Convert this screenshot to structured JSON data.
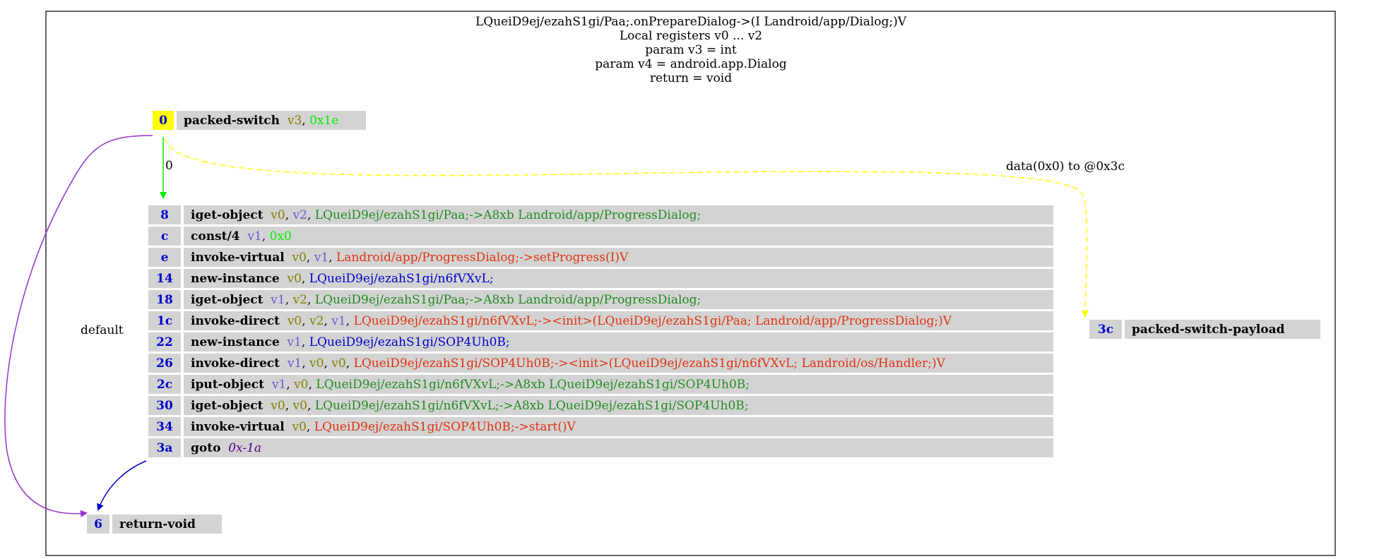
{
  "header": {
    "lines": [
      "LQueiD9ej/ezahS1gi/Paa;.onPrepareDialog->(I Landroid/app/Dialog;)V",
      "Local registers v0 ... v2",
      "param v3 = int",
      "param v4 = android.app.Dialog",
      "return = void"
    ]
  },
  "colors": {
    "frame": "#333333",
    "cell_bg": "#d3d3d3",
    "entry_addr_bg": "#ffff00",
    "addr": "#0000cd",
    "opcode": "#000000",
    "register": "#808000",
    "register_alt": "#6a5acd",
    "literal": "#00ee00",
    "field_ref": "#228b22",
    "method_ref": "#dd3311",
    "type_ref": "#0000cd",
    "offset": "#4b0082",
    "edge_default": "#9932cc",
    "edge_case": "#00ee00",
    "edge_data": "#ffff00",
    "edge_goto": "#0000cd"
  },
  "nodes": {
    "entry": {
      "rows": [
        {
          "addr": "0",
          "op": "packed-switch",
          "args": [
            {
              "t": "v3",
              "c": "register"
            },
            {
              "t": ", ",
              "c": "plain"
            },
            {
              "t": "0x1e",
              "c": "literal"
            }
          ]
        }
      ]
    },
    "body": {
      "rows": [
        {
          "addr": "8",
          "op": "iget-object",
          "args": [
            {
              "t": "v0",
              "c": "register"
            },
            {
              "t": ", ",
              "c": "plain"
            },
            {
              "t": "v2",
              "c": "register_alt"
            },
            {
              "t": ", ",
              "c": "plain"
            },
            {
              "t": "LQueiD9ej/ezahS1gi/Paa;->A8xb Landroid/app/ProgressDialog;",
              "c": "field_ref"
            }
          ]
        },
        {
          "addr": "c",
          "op": "const/4",
          "args": [
            {
              "t": "v1",
              "c": "register_alt"
            },
            {
              "t": ", ",
              "c": "plain"
            },
            {
              "t": "0x0",
              "c": "literal"
            }
          ]
        },
        {
          "addr": "e",
          "op": "invoke-virtual",
          "args": [
            {
              "t": "v0",
              "c": "register"
            },
            {
              "t": ", ",
              "c": "plain"
            },
            {
              "t": "v1",
              "c": "register_alt"
            },
            {
              "t": ", ",
              "c": "plain"
            },
            {
              "t": "Landroid/app/ProgressDialog;->setProgress(I)V",
              "c": "method_ref"
            }
          ]
        },
        {
          "addr": "14",
          "op": "new-instance",
          "args": [
            {
              "t": "v0",
              "c": "register"
            },
            {
              "t": ", ",
              "c": "plain"
            },
            {
              "t": "LQueiD9ej/ezahS1gi/n6fVXvL;",
              "c": "type_ref"
            }
          ]
        },
        {
          "addr": "18",
          "op": "iget-object",
          "args": [
            {
              "t": "v1",
              "c": "register_alt"
            },
            {
              "t": ", ",
              "c": "plain"
            },
            {
              "t": "v2",
              "c": "register"
            },
            {
              "t": ", ",
              "c": "plain"
            },
            {
              "t": "LQueiD9ej/ezahS1gi/Paa;->A8xb Landroid/app/ProgressDialog;",
              "c": "field_ref"
            }
          ]
        },
        {
          "addr": "1c",
          "op": "invoke-direct",
          "args": [
            {
              "t": "v0",
              "c": "register"
            },
            {
              "t": ", ",
              "c": "plain"
            },
            {
              "t": "v2",
              "c": "register"
            },
            {
              "t": ", ",
              "c": "plain"
            },
            {
              "t": "v1",
              "c": "register_alt"
            },
            {
              "t": ", ",
              "c": "plain"
            },
            {
              "t": "LQueiD9ej/ezahS1gi/n6fVXvL;-><init>(LQueiD9ej/ezahS1gi/Paa; Landroid/app/ProgressDialog;)V",
              "c": "method_ref"
            }
          ]
        },
        {
          "addr": "22",
          "op": "new-instance",
          "args": [
            {
              "t": "v1",
              "c": "register_alt"
            },
            {
              "t": ", ",
              "c": "plain"
            },
            {
              "t": "LQueiD9ej/ezahS1gi/SOP4Uh0B;",
              "c": "type_ref"
            }
          ]
        },
        {
          "addr": "26",
          "op": "invoke-direct",
          "args": [
            {
              "t": "v1",
              "c": "register_alt"
            },
            {
              "t": ", ",
              "c": "plain"
            },
            {
              "t": "v0",
              "c": "register"
            },
            {
              "t": ", ",
              "c": "plain"
            },
            {
              "t": "v0",
              "c": "register"
            },
            {
              "t": ", ",
              "c": "plain"
            },
            {
              "t": "LQueiD9ej/ezahS1gi/SOP4Uh0B;-><init>(LQueiD9ej/ezahS1gi/n6fVXvL; Landroid/os/Handler;)V",
              "c": "method_ref"
            }
          ]
        },
        {
          "addr": "2c",
          "op": "iput-object",
          "args": [
            {
              "t": "v1",
              "c": "register_alt"
            },
            {
              "t": ", ",
              "c": "plain"
            },
            {
              "t": "v0",
              "c": "register"
            },
            {
              "t": ", ",
              "c": "plain"
            },
            {
              "t": "LQueiD9ej/ezahS1gi/n6fVXvL;->A8xb LQueiD9ej/ezahS1gi/SOP4Uh0B;",
              "c": "field_ref"
            }
          ]
        },
        {
          "addr": "30",
          "op": "iget-object",
          "args": [
            {
              "t": "v0",
              "c": "register"
            },
            {
              "t": ", ",
              "c": "plain"
            },
            {
              "t": "v0",
              "c": "register"
            },
            {
              "t": ", ",
              "c": "plain"
            },
            {
              "t": "LQueiD9ej/ezahS1gi/n6fVXvL;->A8xb LQueiD9ej/ezahS1gi/SOP4Uh0B;",
              "c": "field_ref"
            }
          ]
        },
        {
          "addr": "34",
          "op": "invoke-virtual",
          "args": [
            {
              "t": "v0",
              "c": "register"
            },
            {
              "t": ", ",
              "c": "plain"
            },
            {
              "t": "LQueiD9ej/ezahS1gi/SOP4Uh0B;->start()V",
              "c": "method_ref"
            }
          ]
        },
        {
          "addr": "3a",
          "op": "goto",
          "args": [
            {
              "t": "0x-1a",
              "c": "offset"
            }
          ]
        }
      ]
    },
    "payload": {
      "rows": [
        {
          "addr": "3c",
          "op": "packed-switch-payload",
          "args": []
        }
      ]
    },
    "exit": {
      "rows": [
        {
          "addr": "6",
          "op": "return-void",
          "args": []
        }
      ]
    }
  },
  "edges": {
    "case_label": "0",
    "data_label": "data(0x0) to @0x3c",
    "default_label": "default"
  }
}
